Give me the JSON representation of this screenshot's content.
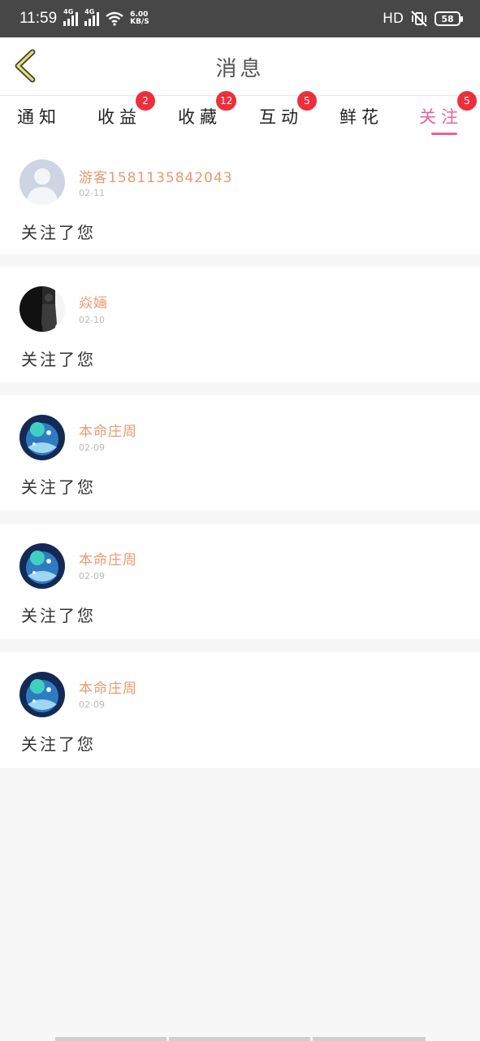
{
  "status_bar": {
    "time": "11:59",
    "sim1": "4G",
    "sim2": "4G",
    "net_speed_value": "6.00",
    "net_speed_unit": "KB/S",
    "hd": "HD",
    "battery": "58"
  },
  "header": {
    "title": "消息",
    "back_icon": "chevron-left-icon"
  },
  "tabs": [
    {
      "label": "通知",
      "badge": "",
      "active": false
    },
    {
      "label": "收益",
      "badge": "2",
      "active": false
    },
    {
      "label": "收藏",
      "badge": "12",
      "active": false
    },
    {
      "label": "互动",
      "badge": "5",
      "active": false
    },
    {
      "label": "鲜花",
      "badge": "",
      "active": false
    },
    {
      "label": "关注",
      "badge": "5",
      "active": true
    }
  ],
  "notifications": [
    {
      "username": "游客15811358420​43",
      "date": "02-11",
      "message": "关注了您",
      "avatar": "default-user-avatar"
    },
    {
      "username": "焱婳",
      "date": "02-10",
      "message": "关注了您",
      "avatar": "dark-portrait-avatar"
    },
    {
      "username": "本命庄周",
      "date": "02-09",
      "message": "关注了您",
      "avatar": "anime-blue-avatar"
    },
    {
      "username": "本命庄周",
      "date": "02-09",
      "message": "关注了您",
      "avatar": "anime-blue-avatar"
    },
    {
      "username": "本命庄周",
      "date": "02-09",
      "message": "关注了您",
      "avatar": "anime-blue-avatar"
    }
  ],
  "colors": {
    "accent": "#e8629a",
    "username": "#e8996e",
    "badge": "#ec2f3b",
    "status_bar": "#474747"
  }
}
